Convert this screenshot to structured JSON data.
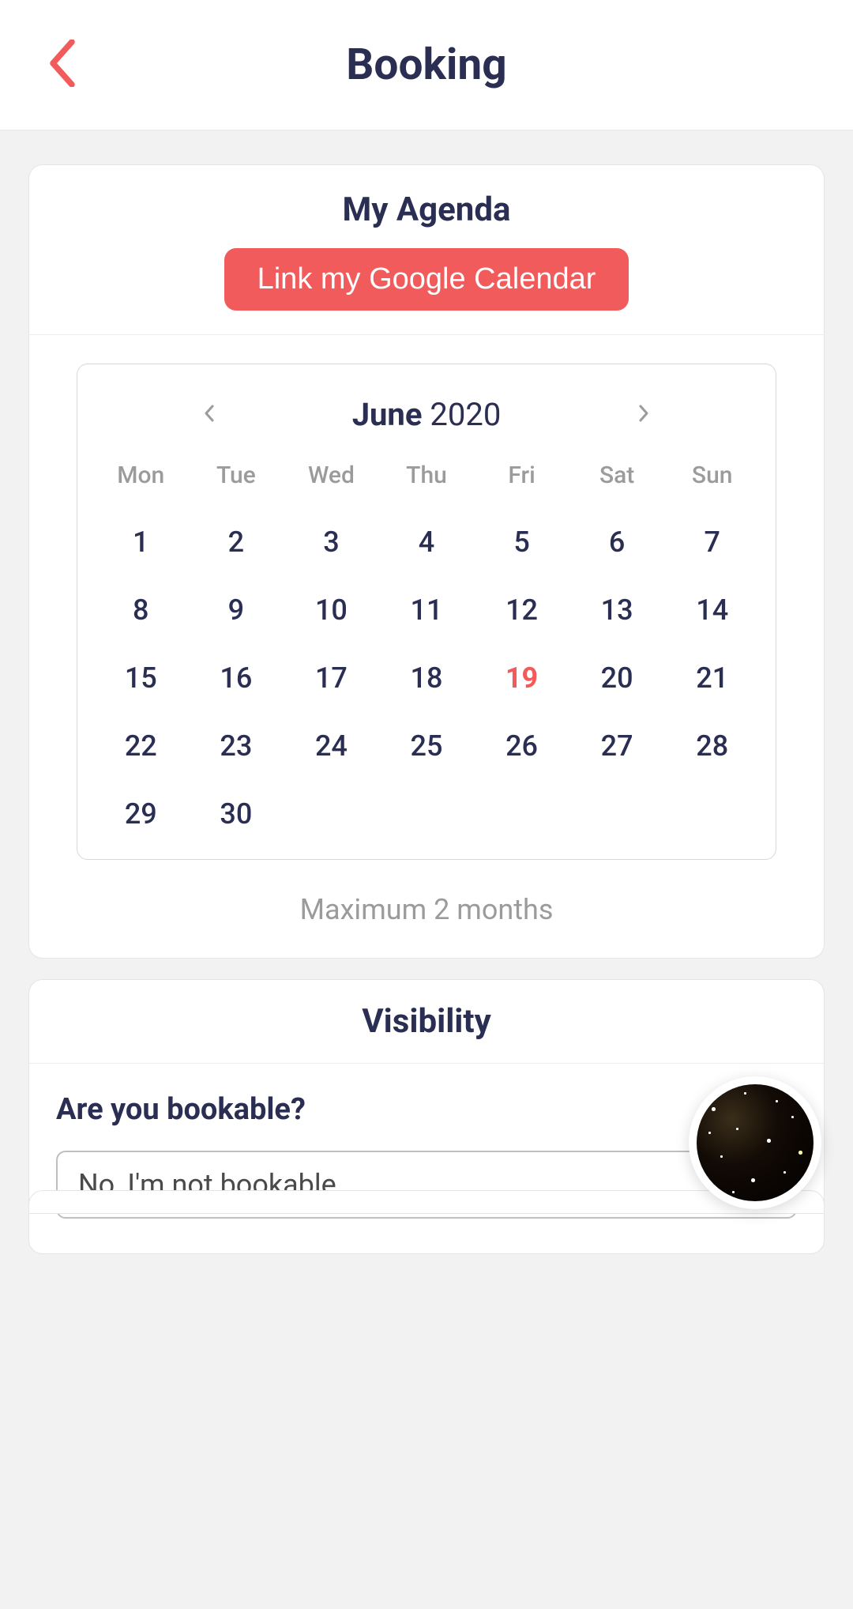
{
  "header": {
    "title": "Booking"
  },
  "agenda": {
    "title": "My Agenda",
    "link_button": "Link my Google Calendar",
    "month": "June",
    "year": "2020",
    "days_of_week": [
      "Mon",
      "Tue",
      "Wed",
      "Thu",
      "Fri",
      "Sat",
      "Sun"
    ],
    "days": [
      1,
      2,
      3,
      4,
      5,
      6,
      7,
      8,
      9,
      10,
      11,
      12,
      13,
      14,
      15,
      16,
      17,
      18,
      19,
      20,
      21,
      22,
      23,
      24,
      25,
      26,
      27,
      28,
      29,
      30
    ],
    "today": 19,
    "note": "Maximum 2 months"
  },
  "visibility": {
    "title": "Visibility",
    "question": "Are you bookable?",
    "selected": "No, I'm not bookable"
  }
}
